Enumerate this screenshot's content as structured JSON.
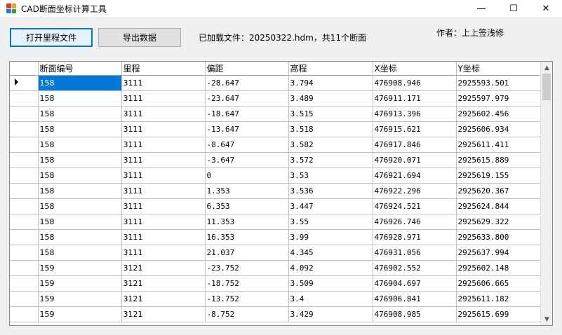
{
  "window": {
    "title": "CAD断面坐标计算工具",
    "controls": {
      "minimize": "—",
      "maximize": "☐",
      "close": "✕"
    }
  },
  "toolbar": {
    "open_label": "打开里程文件",
    "export_label": "导出数据",
    "status_text": "已加载文件：20250322.hdm，共11个断面",
    "author_text": "作者：上上签浅修"
  },
  "grid": {
    "columns": [
      "断面编号",
      "里程",
      "偏距",
      "高程",
      "X坐标",
      "Y坐标"
    ],
    "rows": [
      [
        "158",
        "3111",
        "-28.647",
        "3.794",
        "476908.946",
        "2925593.501"
      ],
      [
        "158",
        "3111",
        "-23.647",
        "3.489",
        "476911.171",
        "2925597.979"
      ],
      [
        "158",
        "3111",
        "-18.647",
        "3.515",
        "476913.396",
        "2925602.456"
      ],
      [
        "158",
        "3111",
        "-13.647",
        "3.518",
        "476915.621",
        "2925606.934"
      ],
      [
        "158",
        "3111",
        "-8.647",
        "3.582",
        "476917.846",
        "2925611.411"
      ],
      [
        "158",
        "3111",
        "-3.647",
        "3.572",
        "476920.071",
        "2925615.889"
      ],
      [
        "158",
        "3111",
        "0",
        "3.53",
        "476921.694",
        "2925619.155"
      ],
      [
        "158",
        "3111",
        "1.353",
        "3.536",
        "476922.296",
        "2925620.367"
      ],
      [
        "158",
        "3111",
        "6.353",
        "3.447",
        "476924.521",
        "2925624.844"
      ],
      [
        "158",
        "3111",
        "11.353",
        "3.55",
        "476926.746",
        "2925629.322"
      ],
      [
        "158",
        "3111",
        "16.353",
        "3.99",
        "476928.971",
        "2925633.800"
      ],
      [
        "158",
        "3111",
        "21.037",
        "4.345",
        "476931.056",
        "2925637.994"
      ],
      [
        "159",
        "3121",
        "-23.752",
        "4.092",
        "476902.552",
        "2925602.148"
      ],
      [
        "159",
        "3121",
        "-18.752",
        "3.509",
        "476904.697",
        "2925606.665"
      ],
      [
        "159",
        "3121",
        "-13.752",
        "3.4",
        "476906.841",
        "2925611.182"
      ],
      [
        "159",
        "3121",
        "-8.752",
        "3.429",
        "476908.985",
        "2925615.699"
      ]
    ]
  }
}
